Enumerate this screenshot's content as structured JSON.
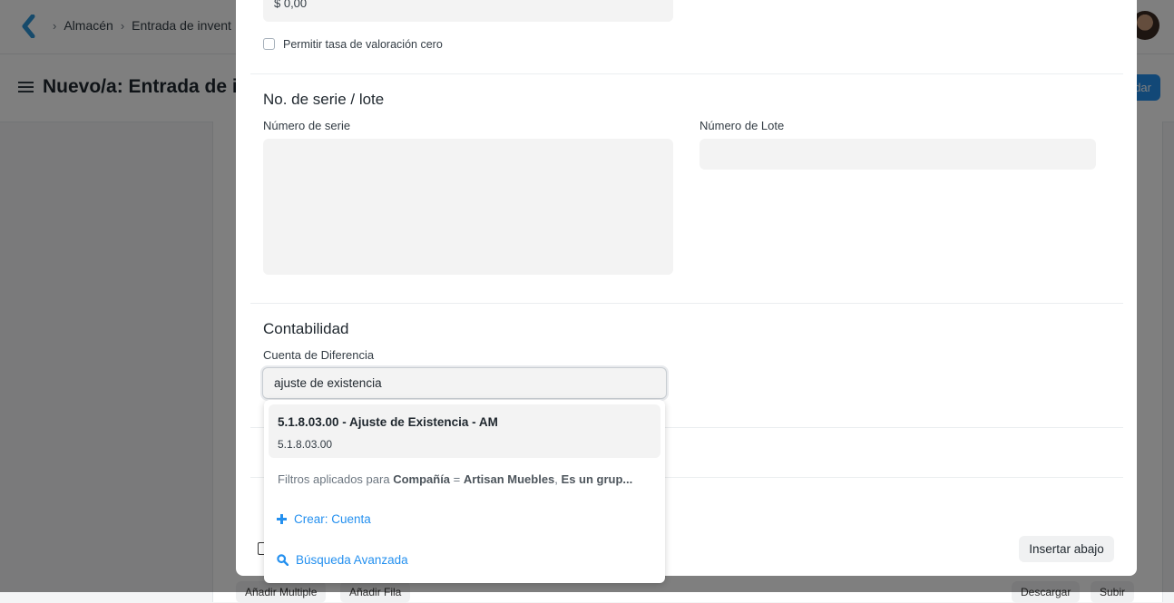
{
  "background": {
    "breadcrumbs": [
      "Almacén",
      "Entrada de invent"
    ],
    "page_title": "Nuevo/a: Entrada de in",
    "save_button": "dar",
    "bottom_buttons": [
      "Añadir Multiple",
      "Añadir Fila",
      "Descargar",
      "Subir"
    ]
  },
  "modal": {
    "rate_value": "$ 0,00",
    "allow_zero_rate_label": "Permitir tasa de valoración cero",
    "serial_section": {
      "title": "No. de serie / lote",
      "serial_label": "Número de serie",
      "batch_label": "Número de Lote"
    },
    "accounting_section": {
      "title": "Contabilidad",
      "difference_account_label": "Cuenta de Diferencia",
      "difference_account_value": "ajuste de existencia"
    },
    "insert_below_button": "Insertar abajo"
  },
  "dropdown": {
    "result": {
      "title": "5.1.8.03.00 - Ajuste de Existencia - AM",
      "subtitle": "5.1.8.03.00"
    },
    "filters": {
      "prefix": "Filtros aplicados para",
      "field1": "Compañía",
      "op": "=",
      "value1": "Artisan Muebles",
      "field2": "Es un grup..."
    },
    "create_label": "Crear: Cuenta",
    "advanced_search_label": "Búsqueda Avanzada"
  },
  "colors": {
    "accent": "#2490ef",
    "overlay": "rgba(0,0,0,0.5)",
    "control_bg": "#f3f3f3"
  }
}
